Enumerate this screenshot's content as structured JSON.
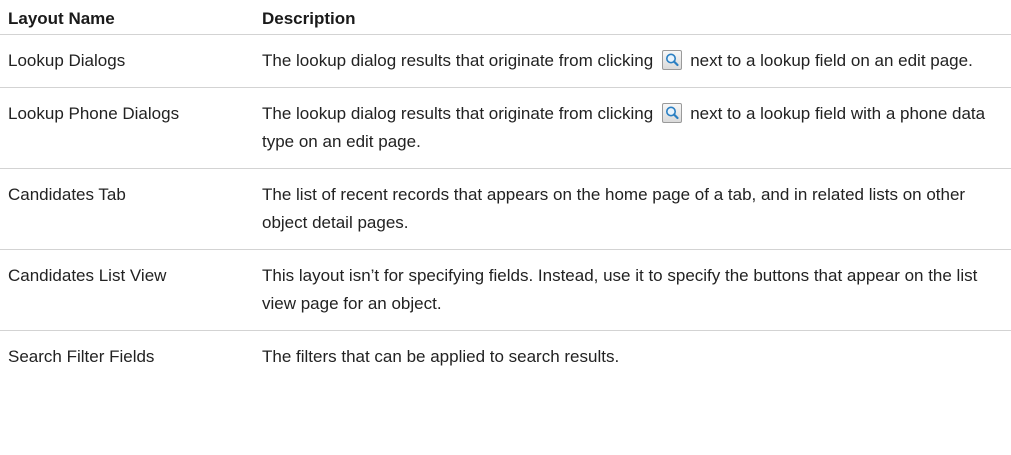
{
  "table": {
    "headers": [
      "Layout Name",
      "Description"
    ],
    "rows": [
      {
        "name": "Lookup Dialogs",
        "desc_before_icon": "The lookup dialog results that originate from clicking",
        "icon": "magnifier-icon",
        "desc_after_icon": "next to a lookup field on an edit page."
      },
      {
        "name": "Lookup Phone Dialogs",
        "desc_before_icon": "The lookup dialog results that originate from clicking",
        "icon": "magnifier-icon",
        "desc_after_icon": "next to a lookup field with a phone data type on an edit page."
      },
      {
        "name": "Candidates Tab",
        "desc": "The list of recent records that appears on the home page of a tab, and in related lists on other object detail pages."
      },
      {
        "name": "Candidates List View",
        "desc": "This layout isn’t for specifying fields. Instead, use it to specify the buttons that appear on the list view page for an object."
      },
      {
        "name": "Search Filter Fields",
        "desc": "The filters that can be applied to search results."
      }
    ]
  },
  "colors": {
    "text": "#1a1a1a",
    "rule": "#d3d3d3",
    "icon_lens": "#2a7fc2"
  }
}
